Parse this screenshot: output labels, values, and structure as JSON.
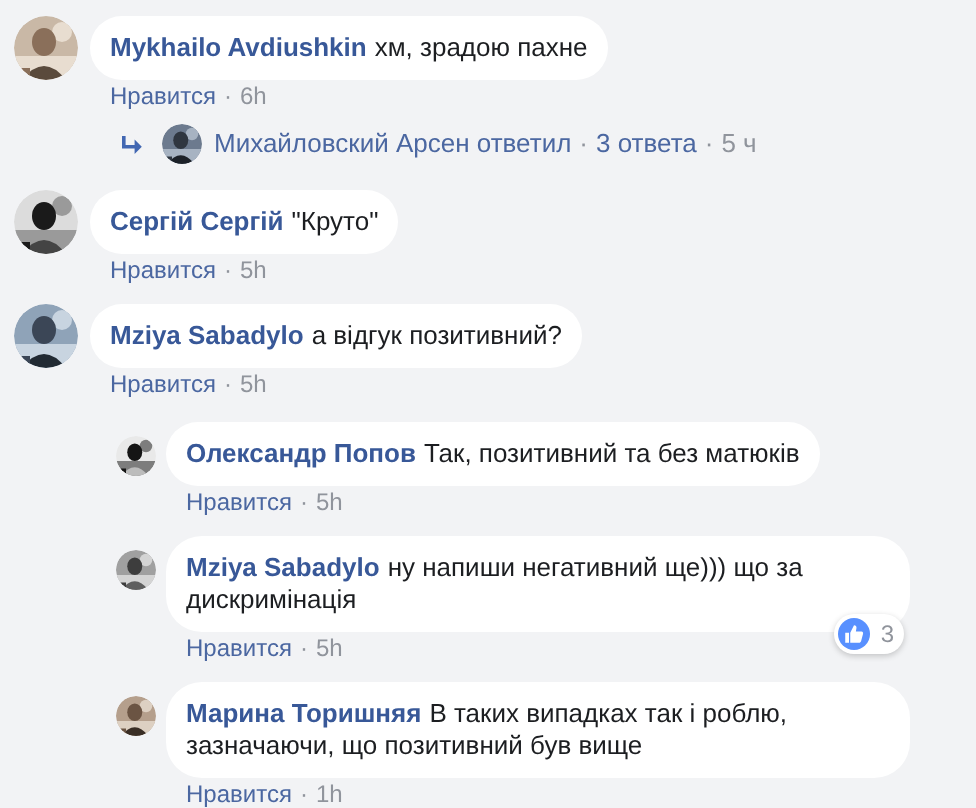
{
  "comments": [
    {
      "name": "Mykhailo Avdiushkin",
      "text": "хм, зрадою пахне",
      "like_link": "Нравится",
      "dot": "·",
      "time": "6h",
      "replies_summary": {
        "author": "Михайловский Арсен ответил",
        "dot_1": "·",
        "count": "3 ответа",
        "dot_2": "·",
        "time": "5 ч"
      }
    },
    {
      "name": "Сергій Сергій",
      "text": "\"Круто\"",
      "like_link": "Нравится",
      "dot": "·",
      "time": "5h"
    },
    {
      "name": "Mziya Sabadylo",
      "text": "а відгук позитивний?",
      "like_link": "Нравится",
      "dot": "·",
      "time": "5h",
      "replies": [
        {
          "name": "Олександр Попов",
          "text": "Так, позитивний та без матюків",
          "like_link": "Нравится",
          "dot": "·",
          "time": "5h"
        },
        {
          "name": "Mziya Sabadylo",
          "text": "ну напиши негативний ще))) що за дискримінація",
          "like_link": "Нравится",
          "dot": "·",
          "time": "5h",
          "reactions": {
            "count": "3"
          }
        },
        {
          "name": "Марина Торишняя",
          "text": "В таких випадках так і роблю, зазначаючи, що позитивний був вище",
          "like_link": "Нравится",
          "dot": "·",
          "time": "1h"
        }
      ]
    }
  ]
}
